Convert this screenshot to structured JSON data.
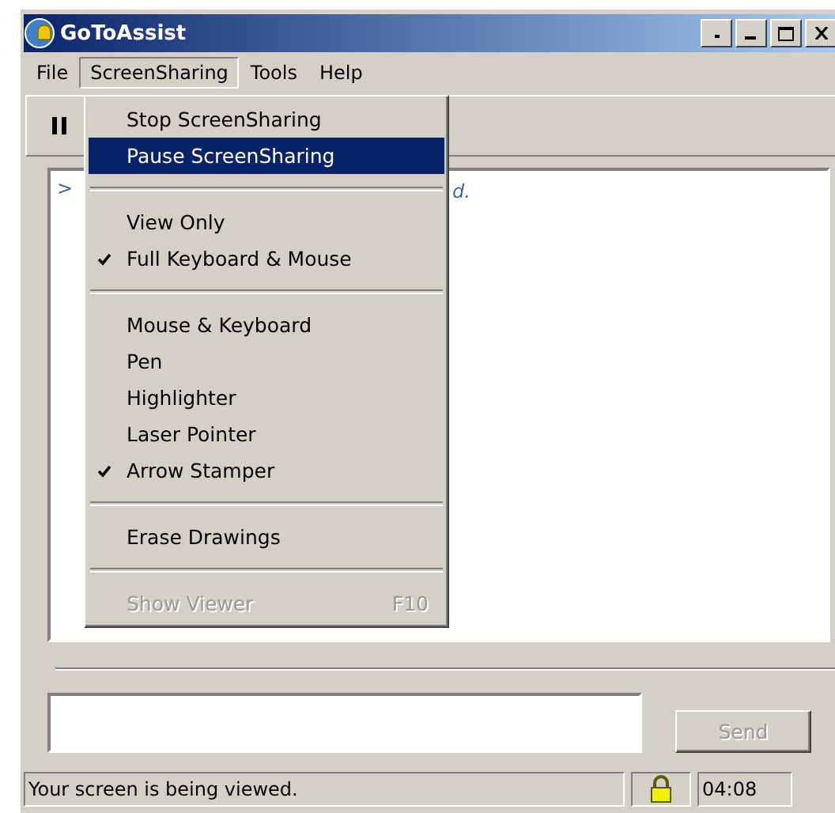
{
  "window": {
    "title": "GoToAssist"
  },
  "menubar": [
    {
      "label": "File",
      "selected": false
    },
    {
      "label": "ScreenSharing",
      "selected": true
    },
    {
      "label": "Tools",
      "selected": false
    },
    {
      "label": "Help",
      "selected": false
    }
  ],
  "chat": {
    "prompt": ">",
    "fragment": "d."
  },
  "menu": [
    {
      "kind": "item",
      "label": "Stop ScreenSharing",
      "checked": false,
      "selected": false,
      "disabled": false
    },
    {
      "kind": "item",
      "label": "Pause ScreenSharing",
      "checked": false,
      "selected": true,
      "disabled": false
    },
    {
      "kind": "separator"
    },
    {
      "kind": "item",
      "label": "View Only",
      "checked": false,
      "selected": false,
      "disabled": false
    },
    {
      "kind": "item",
      "label": "Full Keyboard & Mouse",
      "checked": true,
      "selected": false,
      "disabled": false
    },
    {
      "kind": "separator"
    },
    {
      "kind": "item",
      "label": "Mouse & Keyboard",
      "checked": false,
      "selected": false,
      "disabled": false
    },
    {
      "kind": "item",
      "label": "Pen",
      "checked": false,
      "selected": false,
      "disabled": false
    },
    {
      "kind": "item",
      "label": "Highlighter",
      "checked": false,
      "selected": false,
      "disabled": false
    },
    {
      "kind": "item",
      "label": "Laser Pointer",
      "checked": false,
      "selected": false,
      "disabled": false
    },
    {
      "kind": "item",
      "label": "Arrow Stamper",
      "checked": true,
      "selected": false,
      "disabled": false
    },
    {
      "kind": "separator"
    },
    {
      "kind": "item",
      "label": "Erase Drawings",
      "checked": false,
      "selected": false,
      "disabled": false
    },
    {
      "kind": "separator"
    },
    {
      "kind": "item",
      "label": "Show Viewer",
      "shortcut": "F10",
      "checked": false,
      "selected": false,
      "disabled": true
    }
  ],
  "send_button": {
    "label": "Send",
    "disabled": true
  },
  "status_bar": {
    "message": "Your screen is being viewed.",
    "time": "04:08"
  }
}
